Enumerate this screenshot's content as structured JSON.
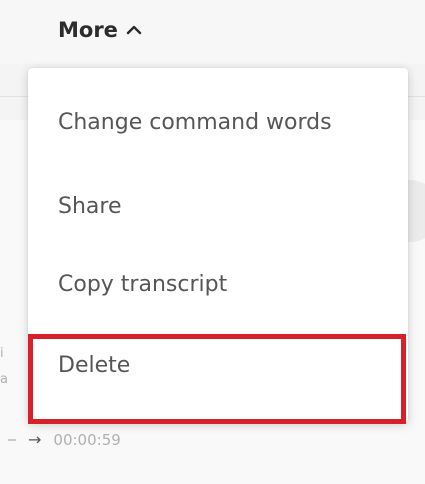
{
  "header": {
    "more_label": "More",
    "more_icon": "chevron-up-icon"
  },
  "menu": {
    "items": [
      {
        "label": "Change command words"
      },
      {
        "label": "Share"
      },
      {
        "label": "Copy transcript"
      },
      {
        "label": "Delete"
      }
    ]
  },
  "background": {
    "time_label": "00:00:59",
    "arrow": "→",
    "frag_a": "i",
    "frag_b": "a"
  },
  "colors": {
    "highlight": "#d6212b",
    "menu_bg": "#ffffff",
    "text": "#565656"
  }
}
